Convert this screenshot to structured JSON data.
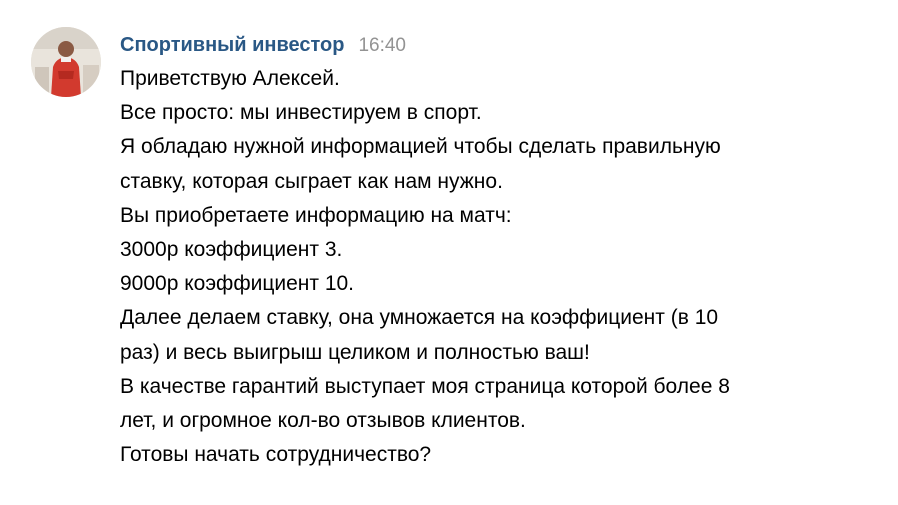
{
  "message": {
    "author": "Спортивный инвестор",
    "time": "16:40",
    "avatar_icon": "user-avatar-photo",
    "lines": [
      "Приветствую Алексей.",
      "Все просто: мы инвестируем в спорт.",
      "Я обладаю нужной информацией чтобы сделать правильную",
      "ставку, которая сыграет как нам нужно.",
      "Вы приобретаете информацию на матч:",
      "3000р коэффициент 3.",
      "9000р коэффициент 10.",
      "Далее делаем ставку, она умножается на коэффициент (в 10",
      "раз) и весь выигрыш целиком и полностью ваш!",
      "В качестве гарантий выступает моя страница которой более 8",
      "лет, и огромное кол-во отзывов клиентов.",
      "Готовы начать сотрудничество?"
    ]
  },
  "colors": {
    "author": "#2a5885",
    "time": "#939393",
    "text": "#000000",
    "background": "#ffffff"
  }
}
